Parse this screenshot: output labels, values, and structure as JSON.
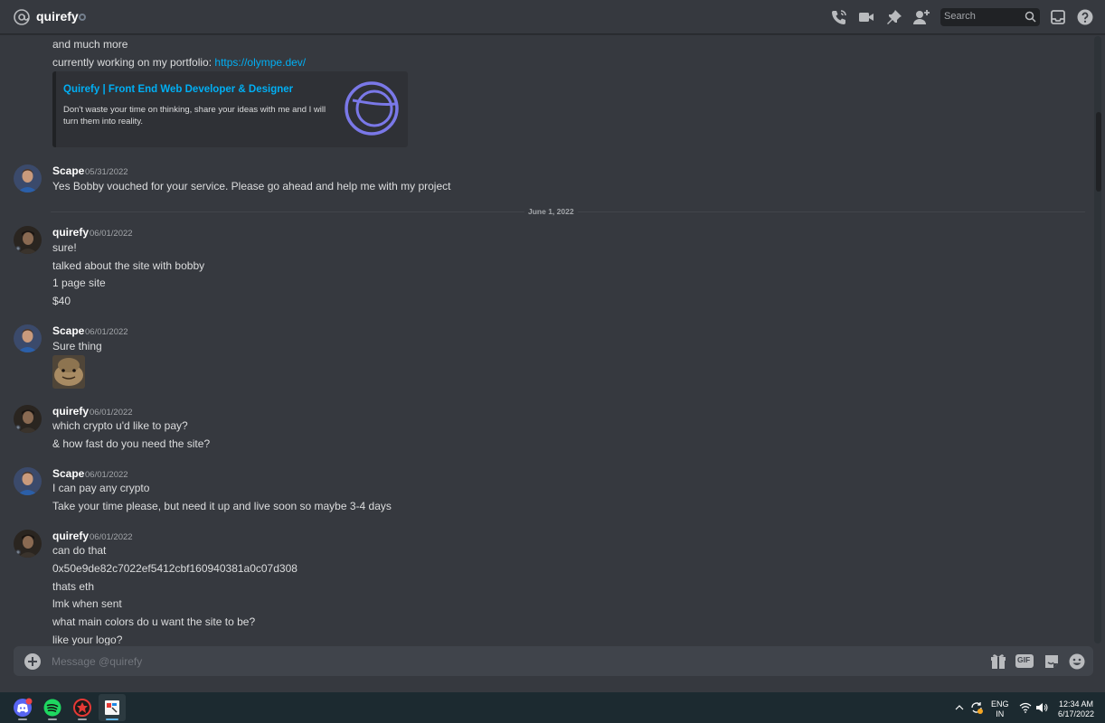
{
  "header": {
    "title": "quirefy",
    "search_placeholder": "Search",
    "icons": [
      "at-icon",
      "phone-call-icon",
      "video-call-icon",
      "pin-icon",
      "add-member-icon",
      "search-icon",
      "inbox-icon",
      "help-icon"
    ]
  },
  "messages": {
    "continuation_lines": [
      "and much more",
      "currently working on my portfolio: "
    ],
    "portfolio_link": "https://olympe.dev/",
    "embed": {
      "title": "Quirefy | Front End Web Developer & Designer",
      "description": "Don't waste your time on thinking, share your ideas with me and I will turn them into reality."
    },
    "groups": [
      {
        "author": "Scape",
        "timestamp": "05/31/2022",
        "lines": [
          "Yes Bobby vouched for your service. Please go ahead and help me with my project"
        ]
      },
      {
        "author": "quirefy",
        "timestamp": "06/01/2022",
        "lines": [
          "sure!",
          "talked about the site with bobby",
          "1 page site",
          "$40"
        ]
      },
      {
        "author": "Scape",
        "timestamp": "06/01/2022",
        "lines": [
          "Sure thing"
        ]
      },
      {
        "author": "quirefy",
        "timestamp": "06/01/2022",
        "lines": [
          "which crypto u'd like to pay?",
          "& how fast do you need the site?"
        ]
      },
      {
        "author": "Scape",
        "timestamp": "06/01/2022",
        "lines": [
          "I can pay any crypto",
          "Take your time please, but need it up and live soon so maybe 3-4 days"
        ]
      },
      {
        "author": "quirefy",
        "timestamp": "06/01/2022",
        "lines": [
          "can do that",
          "0x50e9de82c7022ef5412cbf160940381a0c07d308",
          "thats eth",
          "lmk when sent",
          "what main colors do u want the site to be?",
          "like your logo?"
        ]
      }
    ],
    "date_divider": "June 1, 2022"
  },
  "composer": {
    "placeholder": "Message @quirefy",
    "gif_label": "GIF"
  },
  "taskbar": {
    "apps": [
      "discord-app",
      "spotify-app",
      "red-app",
      "paint-app"
    ],
    "lang_top": "ENG",
    "lang_bottom": "IN",
    "time": "12:34 AM",
    "date": "6/17/2022"
  },
  "colors": {
    "background": "#36393f",
    "link": "#00aff4",
    "embed_bg": "#2f3136",
    "input_bg": "#40444b",
    "taskbar": "#1c2a30",
    "accent": "#5865f2"
  }
}
